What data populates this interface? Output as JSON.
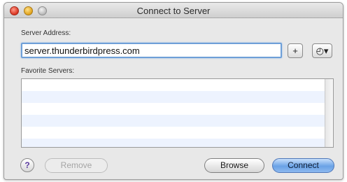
{
  "window": {
    "title": "Connect to Server"
  },
  "server_address": {
    "label": "Server Address:",
    "value": "server.thunderbirdpress.com"
  },
  "buttons": {
    "add": "+",
    "history": "◴▾",
    "help": "?",
    "remove": "Remove",
    "browse": "Browse",
    "connect": "Connect"
  },
  "favorites": {
    "label": "Favorite Servers:",
    "rows": [
      "",
      "",
      "",
      "",
      "",
      ""
    ]
  },
  "colors": {
    "accent": "#6e9fd8",
    "connect_button": "#6aa2e6",
    "stripe": "#edf3fe"
  }
}
